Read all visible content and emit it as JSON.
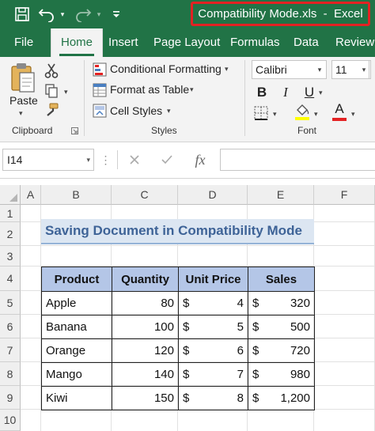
{
  "titlebar": {
    "title": "Compatibility Mode.xls  -  Excel",
    "icons": [
      "save-icon",
      "undo-icon",
      "undo-dropdown-icon",
      "redo-icon",
      "redo-dropdown-icon",
      "customize-toolbar-icon"
    ],
    "accent": "#217346",
    "highlight_border": "#e32223"
  },
  "tabs": [
    "File",
    "Home",
    "Insert",
    "Page Layout",
    "Formulas",
    "Data",
    "Review"
  ],
  "active_tab": "Home",
  "ribbon": {
    "clipboard": {
      "paste_label": "Paste",
      "group_label": "Clipboard"
    },
    "styles": {
      "conditional_formatting": "Conditional Formatting",
      "format_as_table": "Format as Table",
      "cell_styles": "Cell Styles",
      "group_label": "Styles"
    },
    "font": {
      "font_name": "Calibri",
      "font_size": "11",
      "bold": "B",
      "italic": "I",
      "underline": "U",
      "font_color_letter": "A",
      "group_label": "Font",
      "font_color": "#e32223",
      "fill_color": "#ffff00"
    }
  },
  "formula_bar": {
    "name_box": "I14",
    "fx_label": "fx",
    "formula": ""
  },
  "sheet": {
    "columns": [
      "A",
      "B",
      "C",
      "D",
      "E",
      "F"
    ],
    "rows": [
      "1",
      "2",
      "3",
      "4",
      "5",
      "6",
      "7",
      "8",
      "9",
      "10"
    ],
    "heading": "Saving Document in Compatibility Mode",
    "table": {
      "headers": [
        "Product",
        "Quantity",
        "Unit Price",
        "Sales"
      ],
      "currency_symbol": "$",
      "rows": [
        {
          "product": "Apple",
          "quantity": "80",
          "unit_price": "4",
          "sales": "320"
        },
        {
          "product": "Banana",
          "quantity": "100",
          "unit_price": "5",
          "sales": "500"
        },
        {
          "product": "Orange",
          "quantity": "120",
          "unit_price": "6",
          "sales": "720"
        },
        {
          "product": "Mango",
          "quantity": "140",
          "unit_price": "7",
          "sales": "980"
        },
        {
          "product": "Kiwi",
          "quantity": "150",
          "unit_price": "8",
          "sales": "1,200"
        }
      ]
    },
    "header_fill": "#b4c6e7",
    "heading_fill": "#dce6f2",
    "heading_text_color": "#3e6397"
  }
}
